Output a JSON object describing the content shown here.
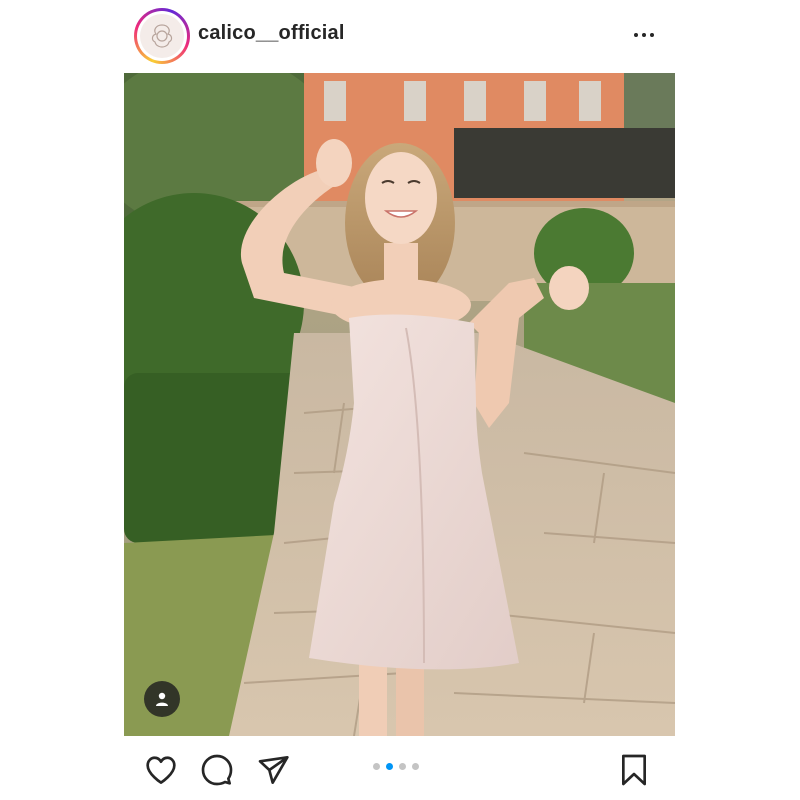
{
  "post": {
    "username": "calico__official",
    "carousel": {
      "total": 4,
      "current": 2
    },
    "colors": {
      "like": "#262626",
      "active_dot": "#0095f6",
      "inactive_dot": "#c4c4c4"
    }
  },
  "icons": {
    "more": "more-options-icon",
    "like": "heart-icon",
    "comment": "comment-icon",
    "share": "paper-plane-icon",
    "save": "bookmark-icon",
    "tag": "user-tag-icon"
  }
}
